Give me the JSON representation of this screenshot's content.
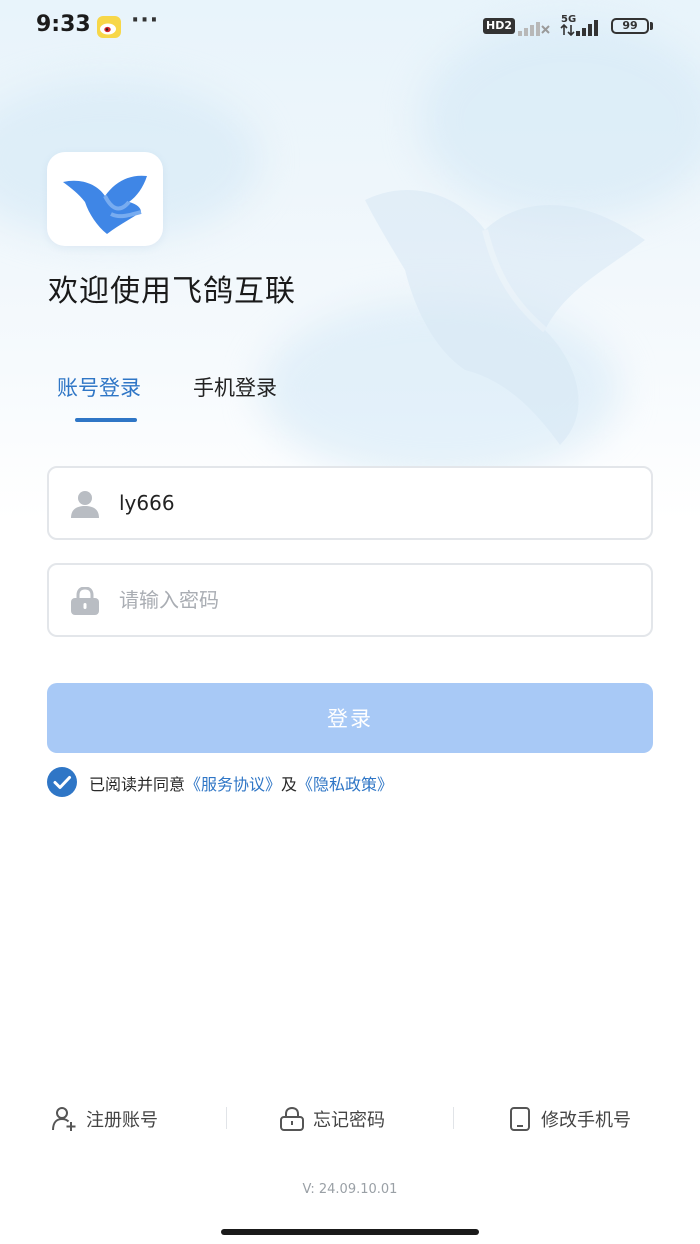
{
  "status_bar": {
    "time": "9:33",
    "more": "···",
    "hd_label": "HD2",
    "network": "5G",
    "battery": "99"
  },
  "app": {
    "welcome": "欢迎使用飞鸽互联",
    "brand_color": "#2f76c6"
  },
  "tabs": [
    {
      "label": "账号登录",
      "active": true
    },
    {
      "label": "手机登录",
      "active": false
    }
  ],
  "form": {
    "username_value": "ly666",
    "password_placeholder": "请输入密码",
    "login_label": "登录"
  },
  "agreement": {
    "checked": true,
    "prefix": "已阅读并同意",
    "service_link": "《服务协议》",
    "joiner": "及",
    "privacy_link": "《隐私政策》"
  },
  "bottom_actions": {
    "register": "注册账号",
    "forgot": "忘记密码",
    "change_phone": "修改手机号"
  },
  "version": "V: 24.09.10.01"
}
